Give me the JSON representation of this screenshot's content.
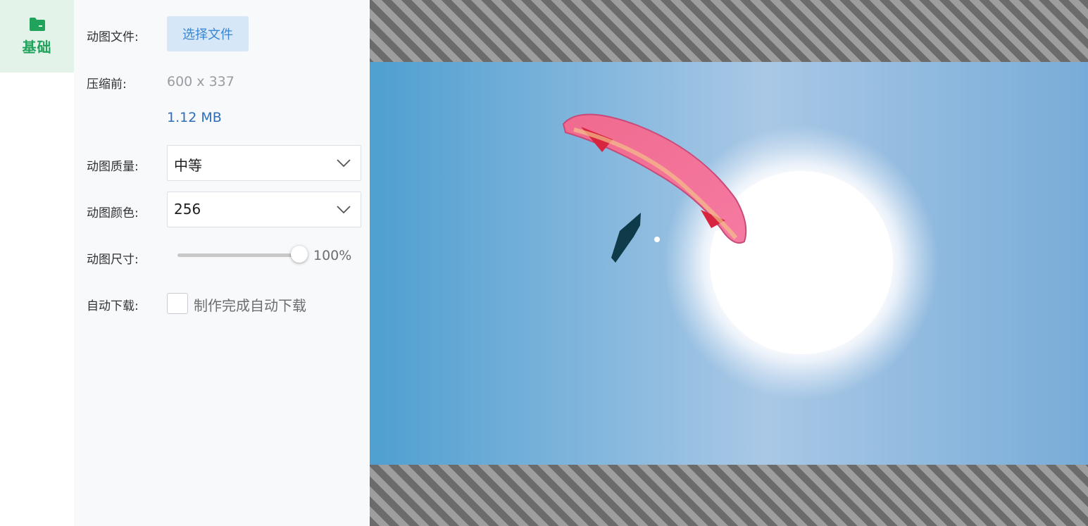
{
  "sidebar": {
    "tab_label": "基础",
    "tab_icon": "folder-icon",
    "accent": "#22a35c"
  },
  "settings": {
    "file": {
      "label": "动图文件:",
      "button": "选择文件"
    },
    "before": {
      "label": "压缩前:",
      "dimensions": "600 x 337",
      "filesize": "1.12 MB"
    },
    "quality": {
      "label": "动图质量:",
      "value": "中等"
    },
    "colors": {
      "label": "动图颜色:",
      "value": "256"
    },
    "size": {
      "label": "动图尺寸:",
      "value_text": "100%",
      "value": 1.0
    },
    "auto_download": {
      "label": "自动下载:",
      "checkbox_text": "制作完成自动下载",
      "checked": false
    }
  },
  "preview": {
    "image": "paraglider-sun-photo"
  }
}
